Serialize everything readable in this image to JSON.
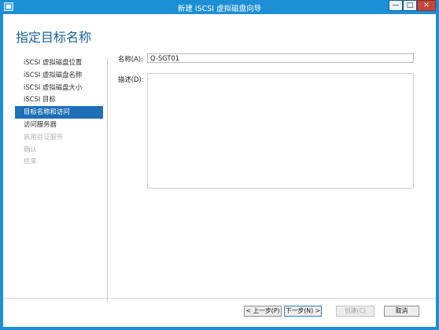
{
  "window": {
    "title": "新建 iSCSI 虚拟磁盘向导",
    "min_label": "—",
    "max_label": "□",
    "close_label": "✕"
  },
  "header": {
    "title": "指定目标名称"
  },
  "steps": [
    {
      "label": "iSCSI 虚拟磁盘位置",
      "state": "done"
    },
    {
      "label": "iSCSI 虚拟磁盘名称",
      "state": "done"
    },
    {
      "label": "iSCSI 虚拟磁盘大小",
      "state": "done"
    },
    {
      "label": "iSCSI 目标",
      "state": "done"
    },
    {
      "label": "目标名称和访问",
      "state": "active"
    },
    {
      "label": "访问服务器",
      "state": "pending"
    },
    {
      "label": "启用验证服务",
      "state": "disabled"
    },
    {
      "label": "确认",
      "state": "disabled"
    },
    {
      "label": "结果",
      "state": "disabled"
    }
  ],
  "form": {
    "name_label": "名称(A):",
    "name_value": "Q-SGT01",
    "desc_label": "描述(D):",
    "desc_value": ""
  },
  "buttons": {
    "prev": "< 上一步(P)",
    "next": "下一步(N) >",
    "create": "创建(C)",
    "cancel": "取消"
  }
}
